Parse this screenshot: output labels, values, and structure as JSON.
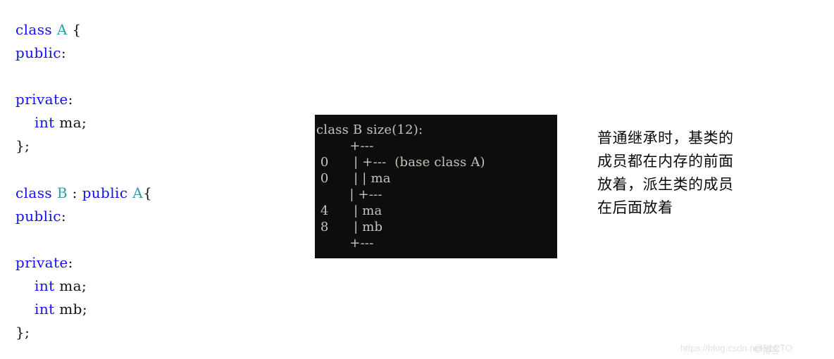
{
  "page": {
    "background": "#ffffff",
    "keyword_color": "#1310f0",
    "classname_color": "#2f9fa8",
    "plain_color": "#111111",
    "terminal_bg": "#0d0d0d",
    "terminal_fg": "#c9c4bb"
  },
  "code_a": {
    "title": "class A definition",
    "lines": [
      [
        {
          "t": "class ",
          "c": "kw"
        },
        {
          "t": "A",
          "c": "cls"
        },
        {
          "t": " {",
          "c": "pln"
        }
      ],
      [
        {
          "t": "public",
          "c": "kw"
        },
        {
          "t": ":",
          "c": "pln"
        }
      ],
      [],
      [
        {
          "t": "private",
          "c": "kw"
        },
        {
          "t": ":",
          "c": "pln"
        }
      ],
      [
        {
          "t": "    ",
          "c": "pln"
        },
        {
          "t": "int",
          "c": "kw"
        },
        {
          "t": " ma;",
          "c": "pln"
        }
      ],
      [
        {
          "t": "};",
          "c": "pln"
        }
      ]
    ]
  },
  "code_b": {
    "title": "class B definition",
    "lines": [
      [
        {
          "t": "class ",
          "c": "kw"
        },
        {
          "t": "B",
          "c": "cls"
        },
        {
          "t": " : ",
          "c": "pln"
        },
        {
          "t": "public ",
          "c": "kw"
        },
        {
          "t": "A",
          "c": "cls"
        },
        {
          "t": "{",
          "c": "pln"
        }
      ],
      [
        {
          "t": "public",
          "c": "kw"
        },
        {
          "t": ":",
          "c": "pln"
        }
      ],
      [],
      [
        {
          "t": "private",
          "c": "kw"
        },
        {
          "t": ":",
          "c": "pln"
        }
      ],
      [
        {
          "t": "    ",
          "c": "pln"
        },
        {
          "t": "int",
          "c": "kw"
        },
        {
          "t": " ma;",
          "c": "pln"
        }
      ],
      [
        {
          "t": "    ",
          "c": "pln"
        },
        {
          "t": "int",
          "c": "kw"
        },
        {
          "t": " mb;",
          "c": "pln"
        }
      ],
      [
        {
          "t": "};",
          "c": "pln"
        }
      ]
    ]
  },
  "terminal": {
    "title": "class B memory layout output",
    "class_name": "B",
    "size_bytes": 12,
    "header": "class B size(12):",
    "lines": [
      "class B size(12):",
      "        +---",
      " 0      | +---  (base class A)",
      " 0      | | ma",
      "        | +---",
      " 4      | ma",
      " 8      | mb",
      "        +---"
    ],
    "members": [
      {
        "offset": "0",
        "name": "(base class A)"
      },
      {
        "offset": "0",
        "name": "ma"
      },
      {
        "offset": "4",
        "name": "ma"
      },
      {
        "offset": "8",
        "name": "mb"
      }
    ]
  },
  "note": {
    "lines": [
      "普通继承时，基类的",
      "成员都在内存的前面",
      "放着，派生类的成员",
      "在后面放着"
    ],
    "full_text": "普通继承时，基类的成员都在内存的前面放着，派生类的成员在后面放着"
  },
  "watermark": {
    "url": "https://blog.csdn.net",
    "handle": "@51CTO",
    "overlay": "博客"
  }
}
